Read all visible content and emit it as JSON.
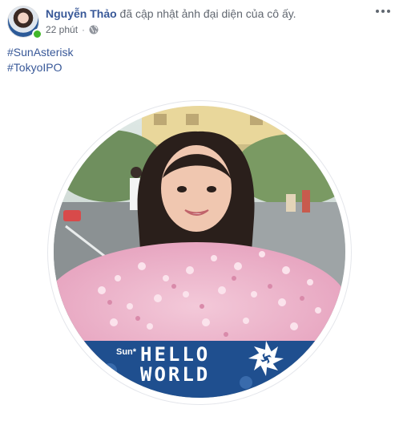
{
  "post": {
    "author": "Nguyễn Thảo",
    "action": " đã cập nhật ảnh đại diện của cô ấy.",
    "time": "22 phút",
    "separator": "·",
    "privacy_icon": "globe-icon",
    "more_icon": "more-horizontal-icon",
    "hashtags": [
      "#SunAsterisk",
      "#TokyoIPO"
    ]
  },
  "photo": {
    "frame_brand": "Sun*",
    "frame_line1": "HELLO",
    "frame_line2": "WORLD",
    "banner_color": "#1f4f8f"
  },
  "colors": {
    "link": "#385898",
    "secondary_text": "#616770",
    "online": "#42b72a"
  }
}
